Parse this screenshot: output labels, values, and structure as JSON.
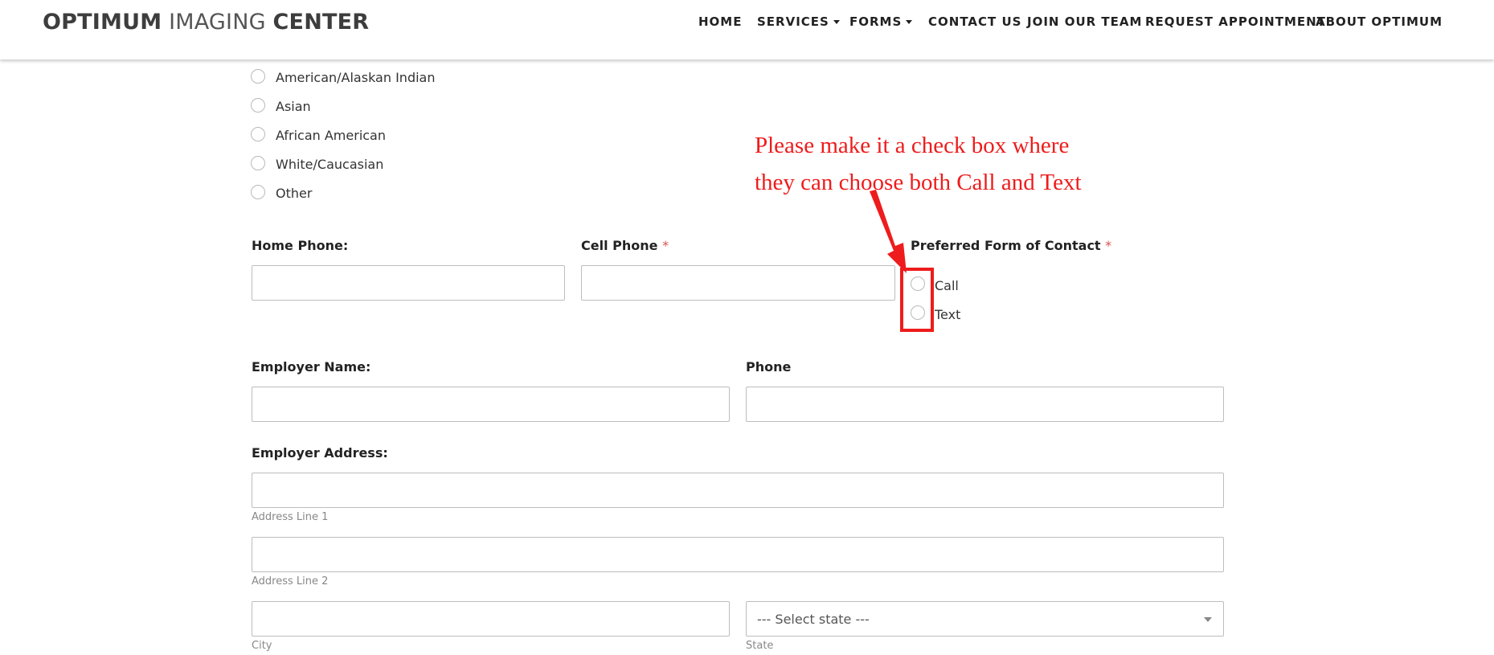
{
  "header": {
    "logo": {
      "part1": "OPTIMUM",
      "part2": "IMAGING",
      "part3": "CENTER"
    },
    "nav": [
      {
        "label": "HOME",
        "dropdown": false
      },
      {
        "label": "SERVICES",
        "dropdown": true
      },
      {
        "label": "FORMS",
        "dropdown": true
      },
      {
        "label": "CONTACT US",
        "dropdown": false
      },
      {
        "label": "JOIN OUR TEAM",
        "dropdown": false
      },
      {
        "label": "REQUEST APPOINTMENT",
        "dropdown": false
      },
      {
        "label": "ABOUT OPTIMUM",
        "dropdown": false
      }
    ]
  },
  "race_options": [
    "American/Alaskan Indian",
    "Asian",
    "African American",
    "White/Caucasian",
    "Other"
  ],
  "phones": {
    "home_label": "Home Phone:",
    "cell_label": "Cell Phone",
    "required_mark": "*",
    "contact_label": "Preferred Form of Contact",
    "contact_options": [
      "Call",
      "Text"
    ]
  },
  "employer": {
    "name_label": "Employer Name:",
    "phone_label": "Phone",
    "address_label": "Employer Address:",
    "address_line1": "Address Line 1",
    "address_line2": "Address Line 2",
    "city": "City",
    "state_label": "State",
    "state_placeholder": "--- Select state ---"
  },
  "annotation": {
    "line1": "Please make it a check box where",
    "line2": "they can choose both Call and Text",
    "color": "#ee1c1c"
  }
}
